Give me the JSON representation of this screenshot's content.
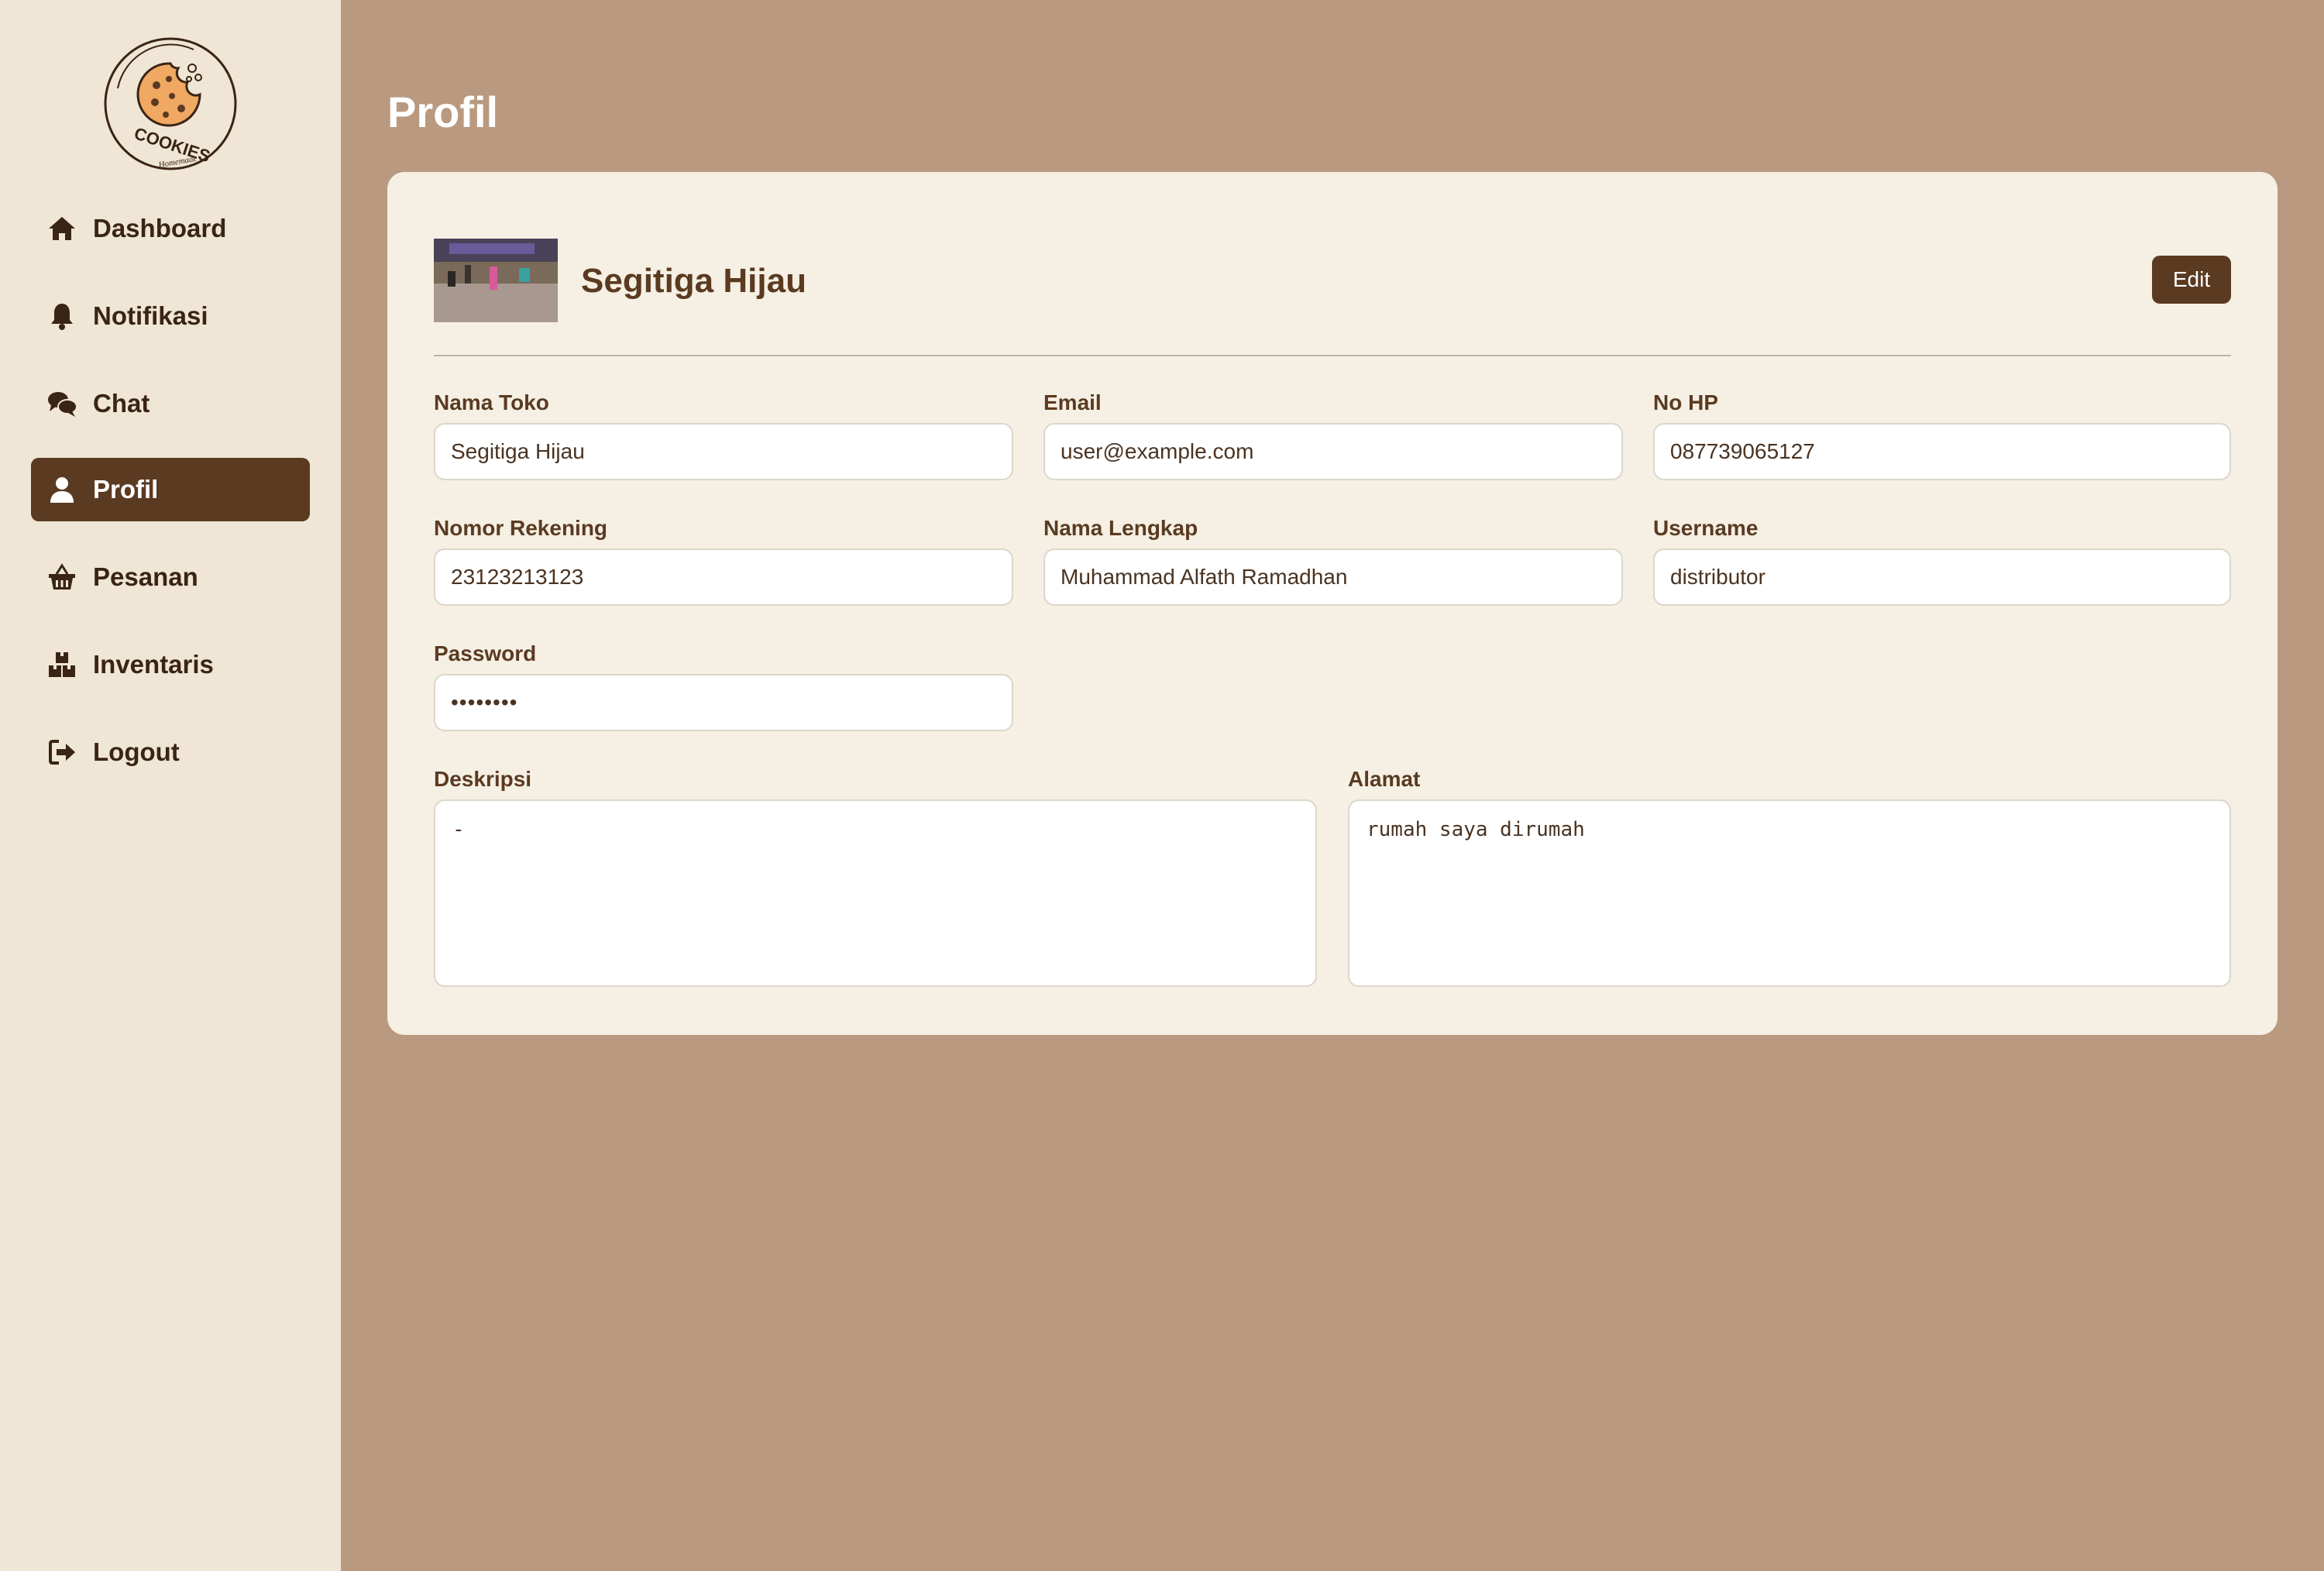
{
  "sidebar": {
    "logo": {
      "brand": "COOKIES",
      "tagline": "Homemade"
    },
    "items": [
      {
        "label": "Dashboard",
        "icon": "home-icon"
      },
      {
        "label": "Notifikasi",
        "icon": "bell-icon"
      },
      {
        "label": "Chat",
        "icon": "chat-icon"
      },
      {
        "label": "Profil",
        "icon": "user-icon",
        "active": true
      },
      {
        "label": "Pesanan",
        "icon": "basket-icon"
      },
      {
        "label": "Inventaris",
        "icon": "boxes-icon"
      },
      {
        "label": "Logout",
        "icon": "logout-icon"
      }
    ]
  },
  "page": {
    "title": "Profil"
  },
  "profile": {
    "name": "Segitiga Hijau",
    "edit_label": "Edit",
    "fields": {
      "nama_toko": {
        "label": "Nama Toko",
        "value": "Segitiga Hijau"
      },
      "email": {
        "label": "Email",
        "value": "user@example.com"
      },
      "no_hp": {
        "label": "No HP",
        "value": "087739065127"
      },
      "nomor_rekening": {
        "label": "Nomor Rekening",
        "value": "23123213123"
      },
      "nama_lengkap": {
        "label": "Nama Lengkap",
        "value": "Muhammad Alfath Ramadhan"
      },
      "username": {
        "label": "Username",
        "value": "distributor"
      },
      "password": {
        "label": "Password",
        "value": "••••••••"
      },
      "deskripsi": {
        "label": "Deskripsi",
        "value": "-"
      },
      "alamat": {
        "label": "Alamat",
        "value": "rumah saya dirumah"
      }
    }
  },
  "colors": {
    "background": "#b99a80",
    "sidebar": "#efe6d5",
    "card": "#f5f0e3",
    "accent": "#5b3a22"
  }
}
